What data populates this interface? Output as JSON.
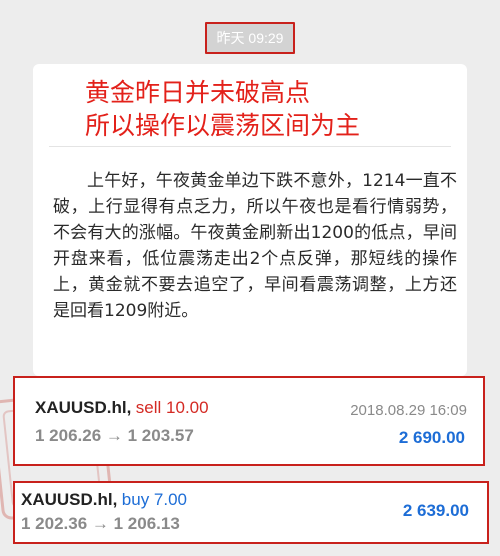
{
  "chat": {
    "timestamp": "昨天 09:29"
  },
  "message": {
    "headline_lines": [
      "黄金昨日并未破高点",
      "所以操作以震荡区间为主"
    ],
    "body_paragraph": "上午好，午夜黄金单边下跌不意外，1214一直不破，上行显得有点乏力，所以午夜也是看行情弱势，不会有大的涨幅。午夜黄金刷新出1200的低点，早间开盘来看，低位震荡走出2个点反弹，那短线的操作上，黄金就不要去追空了，早间看震荡调整，上方还是回看1209附近。"
  },
  "trades": [
    {
      "symbol": "XAUUSD.hl,",
      "action": "sell 10.00",
      "time": "2018.08.29 16:09",
      "prices": "1 206.26 → 1 203.57",
      "profit": "2 690.00"
    },
    {
      "symbol": "XAUUSD.hl,",
      "action": "buy 7.00",
      "prices": "1 202.36 → 1 206.13",
      "profit": "2 639.00"
    }
  ],
  "colors": {
    "accent_red": "#c8211c",
    "buy_blue": "#1d6dd6",
    "sell_red": "#d42a24"
  }
}
